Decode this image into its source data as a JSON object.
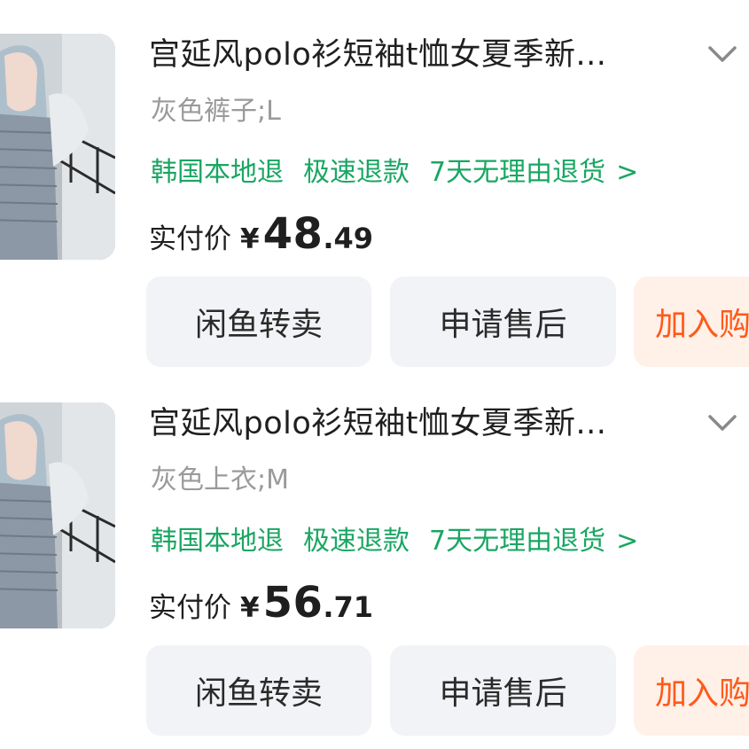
{
  "orders": [
    {
      "title": "宫延风polo衫短袖t恤女夏季新...",
      "sku": "灰色裤子;L",
      "tags": [
        "韩国本地退",
        "极速退款",
        "7天无理由退货"
      ],
      "tags_arrow": ">",
      "price_label": "实付价",
      "price_currency": "¥",
      "price_int": "48",
      "price_dec": ".49",
      "buttons": {
        "resell": "闲鱼转卖",
        "aftersale": "申请售后",
        "cart": "加入购"
      }
    },
    {
      "title": "宫延风polo衫短袖t恤女夏季新...",
      "sku": "灰色上衣;M",
      "tags": [
        "韩国本地退",
        "极速退款",
        "7天无理由退货"
      ],
      "tags_arrow": ">",
      "price_label": "实付价",
      "price_currency": "¥",
      "price_int": "56",
      "price_dec": ".71",
      "buttons": {
        "resell": "闲鱼转卖",
        "aftersale": "申请售后",
        "cart": "加入购"
      }
    }
  ],
  "colors": {
    "tag_green": "#1aa663",
    "cart_orange": "#ff5a1a",
    "cart_bg": "#fff0e8",
    "button_bg": "#f1f3f6",
    "sku_gray": "#9a9a9a"
  },
  "icons": {
    "expand": "chevron-down-icon",
    "tags_more": "chevron-right-icon"
  }
}
